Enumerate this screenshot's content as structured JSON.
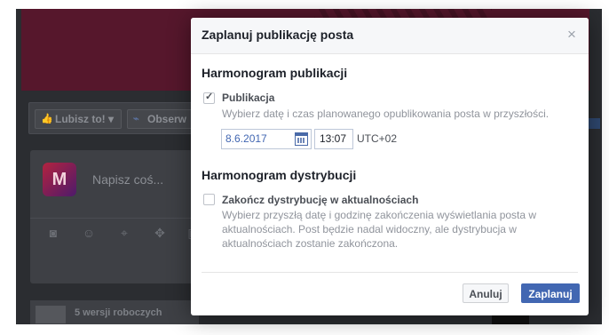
{
  "background": {
    "like_button_label": "Lubisz to!",
    "observe_button_label": "Obserw",
    "composer_placeholder": "Napisz coś...",
    "avatar_letter": "M",
    "drafts_label": "5 wersji roboczych"
  },
  "dialog": {
    "title": "Zaplanuj publikację posta",
    "close_symbol": "×",
    "publication_section": {
      "title": "Harmonogram publikacji",
      "option_label": "Publikacja",
      "option_checked": true,
      "option_description": "Wybierz datę i czas planowanego opublikowania posta w przyszłości.",
      "date_value": "8.6.2017",
      "time_value": "13:07",
      "timezone": "UTC+02"
    },
    "distribution_section": {
      "title": "Harmonogram dystrybucji",
      "option_label": "Zakończ dystrybucję w aktualnościach",
      "option_checked": false,
      "option_description": "Wybierz przyszłą datę i godzinę zakończenia wyświetlania posta w aktualnościach. Post będzie nadal widoczny, ale dystrybucja w aktualnościach zostanie zakończona."
    },
    "cancel_label": "Anuluj",
    "confirm_label": "Zaplanuj"
  },
  "colors": {
    "primary": "#4267b2",
    "overlay": "#2b2d31",
    "cover": "#56172c"
  }
}
